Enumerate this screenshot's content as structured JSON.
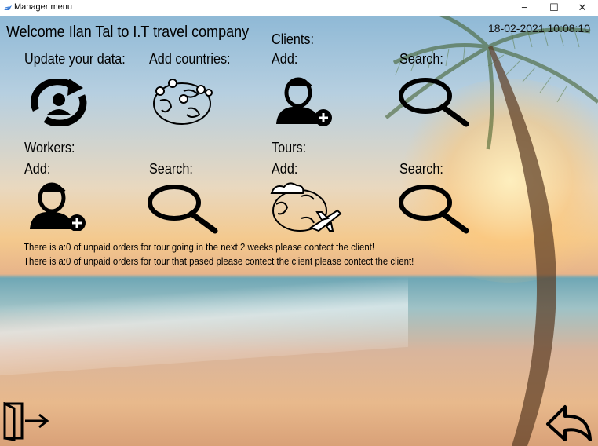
{
  "window": {
    "title": "Manager menu",
    "minimize": "−",
    "maximize": "☐",
    "close": "✕"
  },
  "header": {
    "welcome": "Welcome Ilan Tal to I.T travel company",
    "datetime": "18-02-2021 10:08:10"
  },
  "sections": {
    "update_data": "Update your data:",
    "add_countries": "Add countries:",
    "clients": "Clients:",
    "clients_add": "Add:",
    "clients_search": "Search:",
    "workers": "Workers:",
    "workers_add": "Add:",
    "workers_search": "Search:",
    "tours": "Tours:",
    "tours_add": "Add:",
    "tours_search": "Search:"
  },
  "messages": [
    "There is a:0 of unpaid orders for tour going in the next 2 weeks please contect the client!",
    "There is a:0 of unpaid orders for tour that pased please contect the client please contect the client!"
  ],
  "icons": {
    "update": "user-refresh-icon",
    "countries": "globe-pins-icon",
    "add_client": "add-user-icon",
    "search_client": "search-icon",
    "add_worker": "add-user-icon",
    "search_worker": "search-icon",
    "add_tour": "globe-plane-icon",
    "search_tour": "search-icon",
    "logout": "logout-icon",
    "back": "back-arrow-icon"
  }
}
